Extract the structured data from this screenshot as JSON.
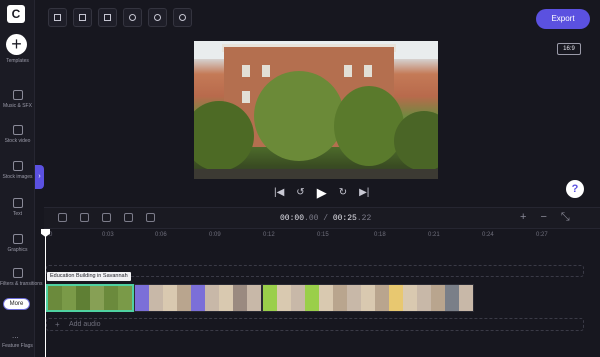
{
  "app": {
    "logo_letter": "C"
  },
  "sidebar": {
    "add_label": "+",
    "items": [
      {
        "label": "Templates"
      },
      {
        "label": "Music & SFX"
      },
      {
        "label": "Stock video"
      },
      {
        "label": "Stock images"
      },
      {
        "label": "Text"
      },
      {
        "label": "Graphics"
      },
      {
        "label": "Filters & transitions"
      }
    ],
    "more_label": "More",
    "dots_label": "...",
    "feature_flags_label": "Feature Flags",
    "collapse_label": "›"
  },
  "toolbar": {
    "tools": [
      "layout-icon",
      "crop-icon",
      "magic-icon",
      "contrast-icon",
      "color-icon",
      "speed-icon"
    ],
    "export_label": "Export",
    "aspect_ratio": "16:9"
  },
  "player": {
    "skip_back_label": "|◀",
    "rewind_label": "↺",
    "play_label": "▶",
    "forward_label": "↻",
    "skip_forward_label": "▶|"
  },
  "help": {
    "label": "?"
  },
  "timeline": {
    "current_time": "00:00",
    "current_frames": ".00",
    "separator": " / ",
    "total_time": "00:25",
    "total_frames": ".22",
    "zoom_in_label": "+",
    "zoom_out_label": "−",
    "fit_label": "⤡",
    "ticks": [
      "0",
      "0:03",
      "0:06",
      "0:09",
      "0:12",
      "0:15",
      "0:18",
      "0:21",
      "0:24",
      "0:27"
    ],
    "clip_title": "Education Building in Savannah",
    "add_audio_label": "Add audio",
    "add_audio_plus": "+",
    "clips": [
      {
        "colors": [
          "#6b8a3c",
          "#7a9a48",
          "#5f7f34",
          "#87a055",
          "#6b8a3c",
          "#7a9a48"
        ],
        "selected": true
      },
      {
        "colors": [
          "#7b6fd8",
          "#c8b8a8",
          "#d9c9b0",
          "#b9a58e",
          "#7b6fd8",
          "#c8b8a8",
          "#d9c9b0",
          "#9a8a80",
          "#c8b8a8"
        ],
        "selected": false
      },
      {
        "colors": [
          "#9acf4a",
          "#d9c9b0",
          "#c8b8a8",
          "#9acf4a",
          "#d9c9b0",
          "#b9a58e",
          "#c8b8a8",
          "#d9c9b0",
          "#b9a58e",
          "#e8c870",
          "#d9c9b0",
          "#c8b8a8",
          "#b9a58e",
          "#7a7f88",
          "#c8b8a8"
        ],
        "selected": false
      }
    ]
  }
}
